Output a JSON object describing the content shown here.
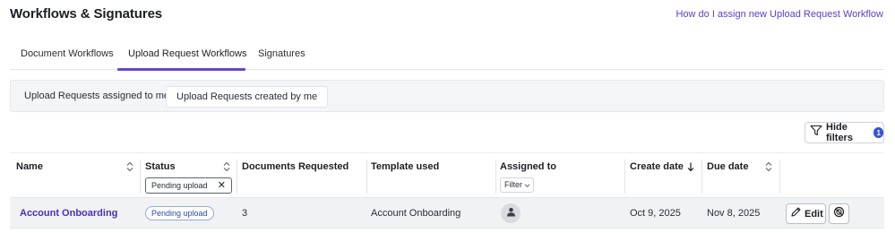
{
  "header": {
    "title": "Workflows & Signatures",
    "help_link": "How do I assign new Upload Request Workflow"
  },
  "tabs": [
    {
      "label": "Document Workflows",
      "active": false
    },
    {
      "label": "Upload Request Workflows",
      "active": true
    },
    {
      "label": "Signatures",
      "active": false
    }
  ],
  "subtabs": [
    {
      "label": "Upload Requests assigned to me",
      "selected": false
    },
    {
      "label": "Upload Requests created by me",
      "selected": true
    }
  ],
  "filters": {
    "hide_label": "Hide filters",
    "active_count": "1",
    "status_value": "Pending upload",
    "assigned_placeholder": "Filter"
  },
  "table": {
    "columns": [
      "Name",
      "Status",
      "Documents Requested",
      "Template used",
      "Assigned to",
      "Create date",
      "Due date"
    ],
    "rows": [
      {
        "name": "Account Onboarding",
        "status": "Pending upload",
        "documents_requested": "3",
        "template_used": "Account Onboarding",
        "assigned_to": "user-avatar-icon",
        "create_date": "Oct 9, 2025",
        "due_date": "Nov 8, 2025",
        "edit_label": "Edit"
      }
    ]
  },
  "colors": {
    "accent": "#6a46d1",
    "link": "#5b3fc4",
    "badge": "#3653e0",
    "status_border": "#93a8e6",
    "row_bg": "#f1f2f4"
  }
}
